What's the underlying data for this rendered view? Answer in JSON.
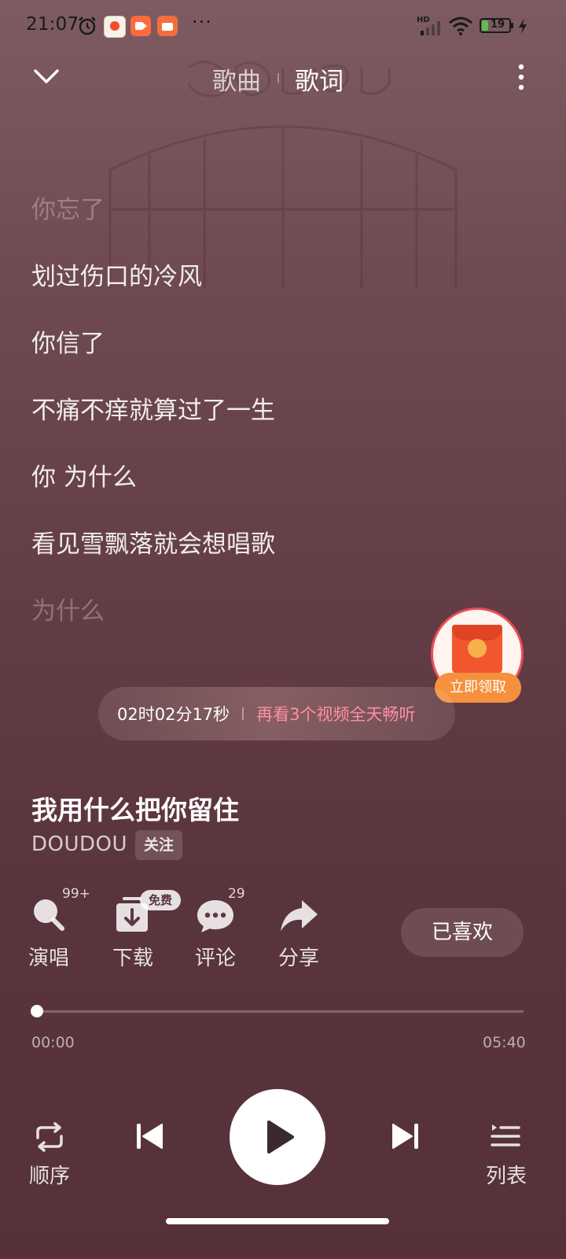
{
  "status_bar": {
    "time": "21:07",
    "more": "···",
    "battery": "19",
    "network": "HD",
    "app_icons": [
      "alarm-icon",
      "app-icon-orange",
      "video-app-icon",
      "shopping-app-icon"
    ]
  },
  "header": {
    "tabs": [
      {
        "label": "歌曲",
        "active": false
      },
      {
        "label": "歌词",
        "active": true
      }
    ],
    "icons": [
      "chevron-down-icon",
      "more-vertical-icon"
    ]
  },
  "lyrics": [
    {
      "text": "你忘了",
      "dim": true
    },
    {
      "text": "划过伤口的冷风",
      "dim": false
    },
    {
      "text": "你信了",
      "dim": false
    },
    {
      "text": "不痛不痒就算过了一生",
      "dim": false
    },
    {
      "text": "你 为什么",
      "dim": false
    },
    {
      "text": "看见雪飘落就会想唱歌",
      "dim": false
    },
    {
      "text": "为什么",
      "dim": true
    }
  ],
  "timer": {
    "time": "02时02分17秒",
    "promo": "再看3个视频全天畅听"
  },
  "red_packet": {
    "label": "立即领取"
  },
  "song": {
    "title": "我用什么把你留住",
    "artist": "DOUDOU",
    "follow": "关注"
  },
  "actions": [
    {
      "label": "演唱",
      "badge": "99+",
      "icon": "microphone-icon"
    },
    {
      "label": "下载",
      "badge": "免费",
      "icon": "download-icon"
    },
    {
      "label": "评论",
      "badge": "29",
      "icon": "comment-icon"
    },
    {
      "label": "分享",
      "badge": "",
      "icon": "share-icon"
    }
  ],
  "liked_button": "已喜欢",
  "progress": {
    "current": "00:00",
    "total": "05:40",
    "fraction": 0.0
  },
  "controls": {
    "order_label": "顺序",
    "list_label": "列表",
    "icons": [
      "repeat-icon",
      "previous-icon",
      "play-icon",
      "next-icon",
      "playlist-icon"
    ]
  },
  "colors": {
    "accent_pink": "#ff8fa3",
    "red_packet": "#f2562f",
    "red_packet_label": "#f5913d"
  }
}
